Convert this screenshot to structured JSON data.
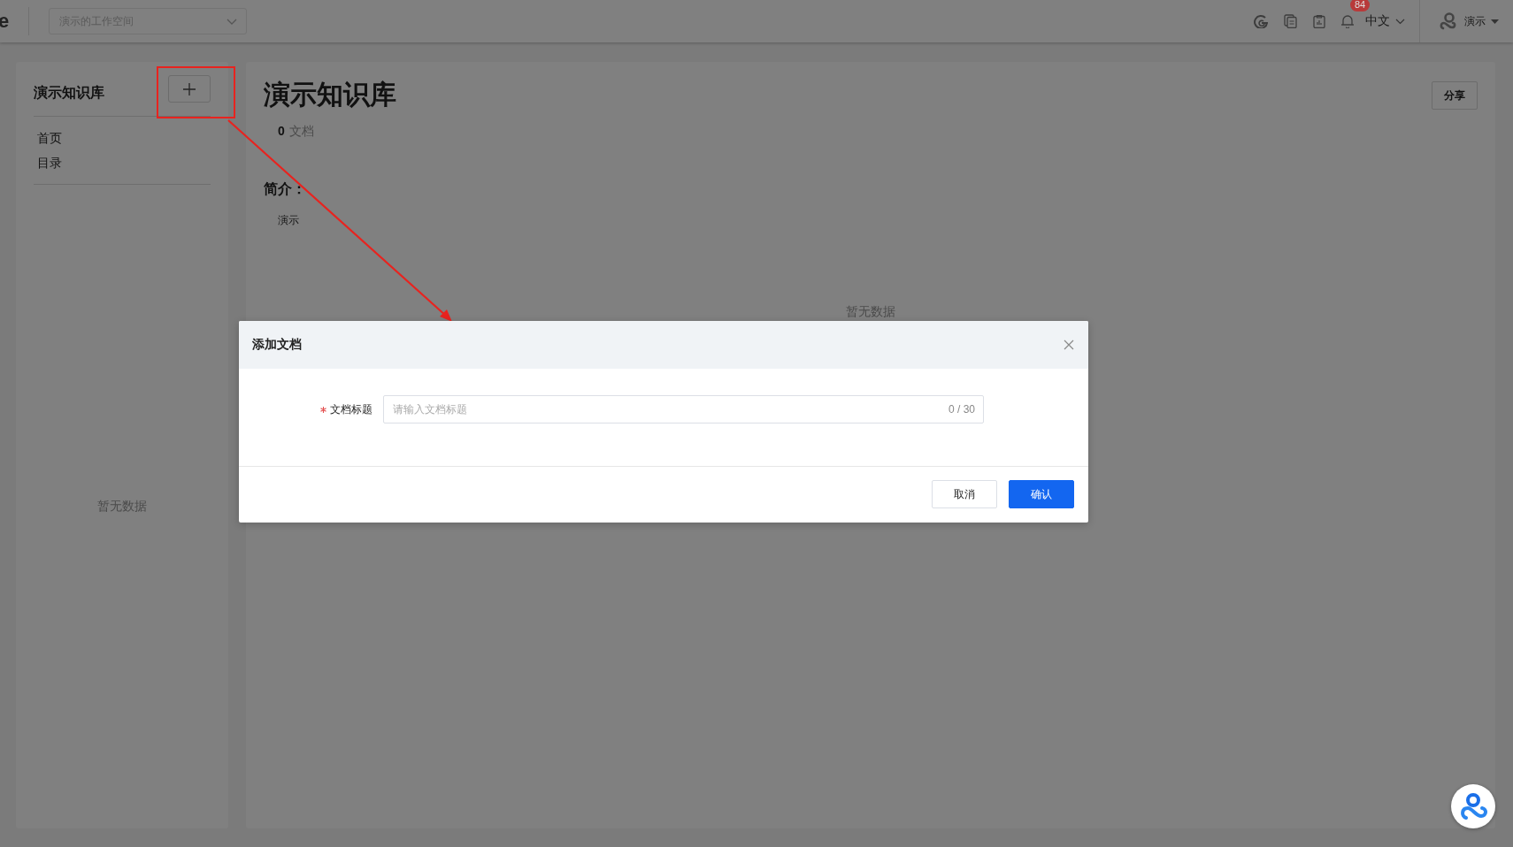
{
  "top_bar": {
    "logo_text": "e",
    "workspace_select": {
      "value": "演示的工作空间"
    },
    "notification_count": "84",
    "language": "中文",
    "user": "演示"
  },
  "sidebar": {
    "title": "演示知识库",
    "items": [
      {
        "label": "首页"
      },
      {
        "label": "目录"
      }
    ],
    "empty_text": "暂无数据"
  },
  "main": {
    "title": "演示知识库",
    "doc_count": "0",
    "doc_count_unit": "文档",
    "share_button": "分享",
    "intro_label": "简介：",
    "intro_text": "演示",
    "empty_text": "暂无数据"
  },
  "dialog": {
    "title": "添加文档",
    "fields": [
      {
        "label": "文档标题",
        "required": true,
        "placeholder": "请输入文档标题",
        "counter": "0 / 30"
      }
    ],
    "buttons": [
      {
        "label": "取消",
        "kind": "default"
      },
      {
        "label": "确认",
        "kind": "primary"
      }
    ]
  }
}
